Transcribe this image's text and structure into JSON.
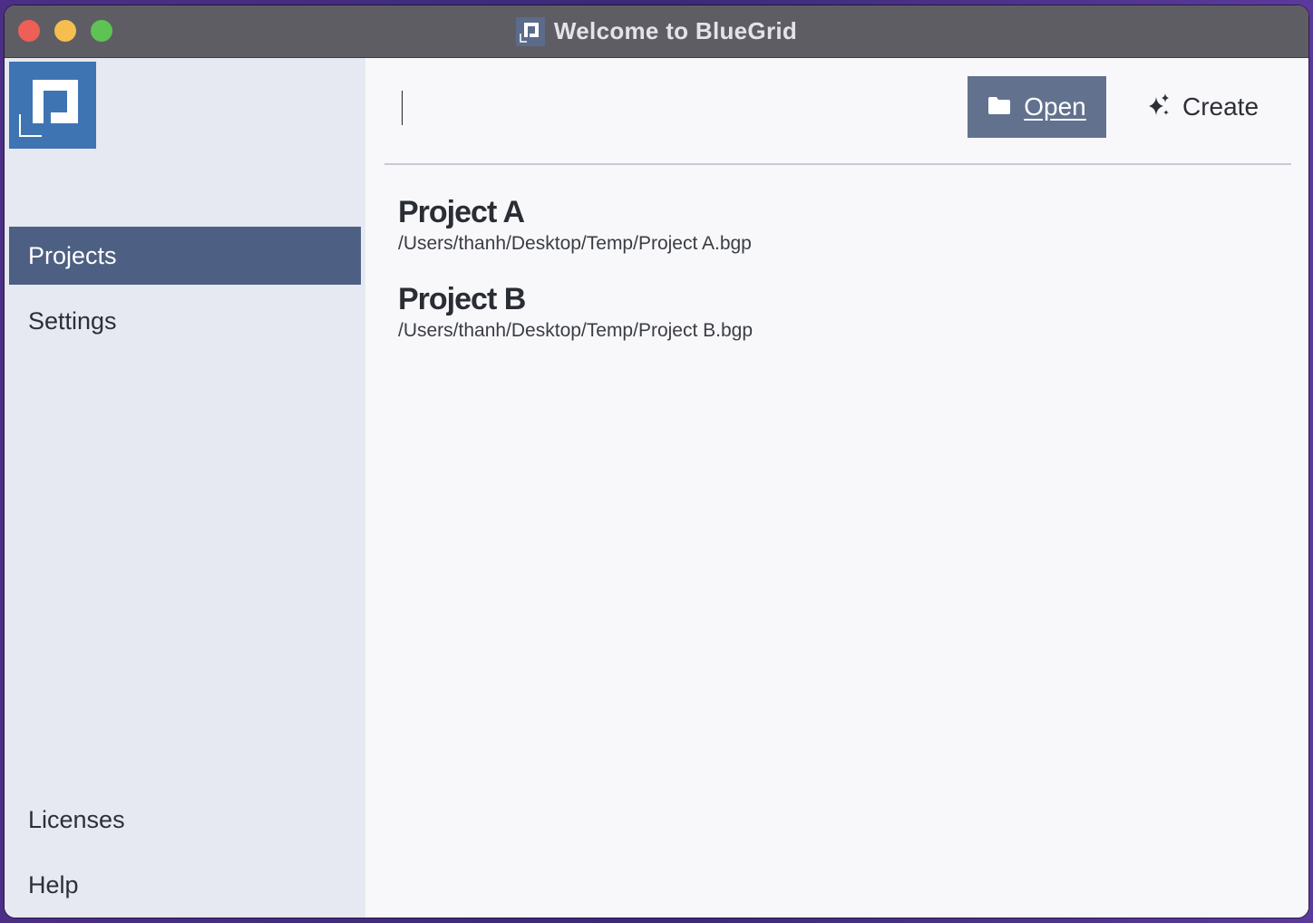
{
  "window": {
    "title": "Welcome to BlueGrid"
  },
  "colors": {
    "accent": "#4d6083",
    "open_button": "#62728e",
    "logo": "#3f74b3",
    "sidebar_bg": "#e6e9f1",
    "titlebar": "#5f5d64"
  },
  "sidebar": {
    "logo_icon": "bluegrid-logo-icon",
    "top_items": [
      {
        "label": "Projects",
        "active": true
      },
      {
        "label": "Settings",
        "active": false
      }
    ],
    "bottom_items": [
      {
        "label": "Licenses"
      },
      {
        "label": "Help"
      }
    ]
  },
  "toolbar": {
    "search_value": "",
    "open_label": "Open",
    "open_icon": "folder-icon",
    "create_label": "Create",
    "create_icon": "sparkle-icon"
  },
  "projects": [
    {
      "name": "Project A",
      "path": "/Users/thanh/Desktop/Temp/Project A.bgp"
    },
    {
      "name": "Project B",
      "path": "/Users/thanh/Desktop/Temp/Project B.bgp"
    }
  ]
}
